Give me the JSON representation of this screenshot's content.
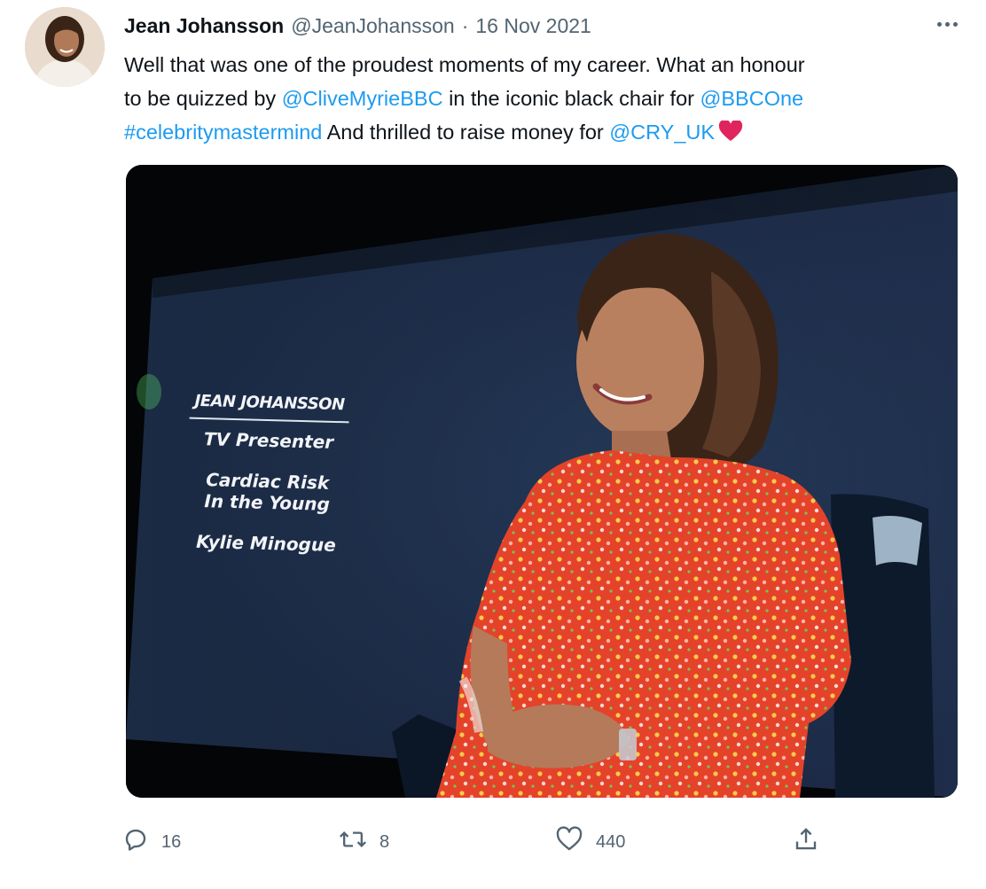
{
  "author": {
    "display_name": "Jean Johansson",
    "handle": "@JeanJohansson",
    "separator": "·",
    "date": "16 Nov 2021"
  },
  "tweet": {
    "line1": "Well that was one of the proudest moments of my career. What an honour",
    "line2_a": "to be quizzed by ",
    "mention_clive": "@CliveMyrieBBC",
    "line2_b": " in the iconic black chair for ",
    "mention_bbc": "@BBCOne",
    "hashtag": "#celebritymastermind",
    "line3_b": " And thrilled to raise money for ",
    "mention_cry": "@CRY_UK",
    "emoji": "red-heart"
  },
  "media": {
    "caption_name": "JEAN JOHANSSON",
    "caption_role": "TV Presenter",
    "caption_charity_1": "Cardiac Risk",
    "caption_charity_2": "In the Young",
    "caption_subject": "Kylie Minogue"
  },
  "actions": {
    "reply_count": "16",
    "retweet_count": "8",
    "like_count": "440"
  },
  "icons": {
    "reply": "reply-icon",
    "retweet": "retweet-icon",
    "like": "heart-icon",
    "share": "share-icon",
    "more": "more-icon"
  },
  "colors": {
    "text": "#0f1419",
    "secondary": "#536471",
    "link": "#1d9bf0",
    "heart": "#e0245e"
  }
}
